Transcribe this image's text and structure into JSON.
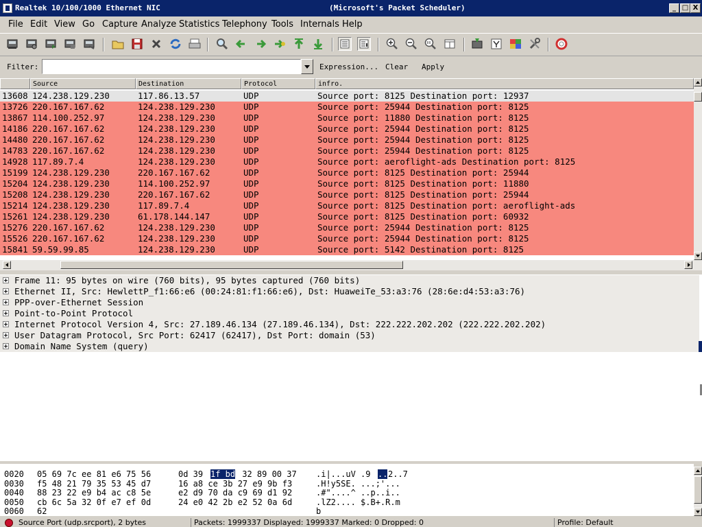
{
  "window": {
    "title_left": "Realtek 10/100/1000 Ethernet NIC",
    "title_right": "(Microsoft's Packet Scheduler)",
    "minimize": "_",
    "maximize": "□",
    "close": "X"
  },
  "menu": [
    "File",
    "Edit",
    "View",
    "Go",
    "Capture",
    "Analyze",
    "Statistics",
    "Telephony",
    "Tools",
    "Internals",
    "Help"
  ],
  "filter": {
    "label": "Filter:",
    "value": "",
    "expression": "Expression...",
    "clear": "Clear",
    "apply": "Apply"
  },
  "packet_list": {
    "columns": [
      "Source",
      "Destination",
      "Protocol",
      "infro."
    ],
    "rows": [
      {
        "no": "13608",
        "src": "124.238.129.230",
        "dst": "117.86.13.57",
        "proto": "UDP",
        "info": "Source port: 8125  Destination port: 12937",
        "color": "normal"
      },
      {
        "no": "13726",
        "src": "220.167.167.62",
        "dst": "124.238.129.230",
        "proto": "UDP",
        "info": "Source port: 25944  Destination port: 8125",
        "color": "red"
      },
      {
        "no": "13867",
        "src": "114.100.252.97",
        "dst": "124.238.129.230",
        "proto": "UDP",
        "info": "Source port: 11880  Destination port: 8125",
        "color": "red"
      },
      {
        "no": "14186",
        "src": "220.167.167.62",
        "dst": "124.238.129.230",
        "proto": "UDP",
        "info": "Source port: 25944  Destination port: 8125",
        "color": "red"
      },
      {
        "no": "14480",
        "src": "220.167.167.62",
        "dst": "124.238.129.230",
        "proto": "UDP",
        "info": "Source port: 25944  Destination port: 8125",
        "color": "red"
      },
      {
        "no": "14783",
        "src": "220.167.167.62",
        "dst": "124.238.129.230",
        "proto": "UDP",
        "info": "Source port: 25944  Destination port: 8125",
        "color": "red"
      },
      {
        "no": "14928",
        "src": "117.89.7.4",
        "dst": "124.238.129.230",
        "proto": "UDP",
        "info": "Source port: aeroflight-ads  Destination port: 8125",
        "color": "red"
      },
      {
        "no": "15199",
        "src": "124.238.129.230",
        "dst": "220.167.167.62",
        "proto": "UDP",
        "info": "Source port: 8125  Destination port: 25944",
        "color": "red"
      },
      {
        "no": "15204",
        "src": "124.238.129.230",
        "dst": "114.100.252.97",
        "proto": "UDP",
        "info": "Source port: 8125  Destination port: 11880",
        "color": "red"
      },
      {
        "no": "15208",
        "src": "124.238.129.230",
        "dst": "220.167.167.62",
        "proto": "UDP",
        "info": "Source port: 8125  Destination port: 25944",
        "color": "red"
      },
      {
        "no": "15214",
        "src": "124.238.129.230",
        "dst": "117.89.7.4",
        "proto": "UDP",
        "info": "Source port: 8125  Destination port: aeroflight-ads",
        "color": "red"
      },
      {
        "no": "15261",
        "src": "124.238.129.230",
        "dst": "61.178.144.147",
        "proto": "UDP",
        "info": "Source port: 8125  Destination port: 60932",
        "color": "red"
      },
      {
        "no": "15276",
        "src": "220.167.167.62",
        "dst": "124.238.129.230",
        "proto": "UDP",
        "info": "Source port: 25944  Destination port: 8125",
        "color": "red"
      },
      {
        "no": "15526",
        "src": "220.167.167.62",
        "dst": "124.238.129.230",
        "proto": "UDP",
        "info": "Source port: 25944  Destination port: 8125",
        "color": "red"
      },
      {
        "no": "15841",
        "src": "59.59.99.85",
        "dst": "124.238.129.230",
        "proto": "UDP",
        "info": "Source port: 5142  Destination port: 8125",
        "color": "red"
      }
    ]
  },
  "details": [
    "Frame 11: 95 bytes on wire (760 bits), 95 bytes captured (760 bits)",
    "Ethernet II, Src: HewlettP_f1:66:e6 (00:24:81:f1:66:e6), Dst: HuaweiTe_53:a3:76 (28:6e:d4:53:a3:76)",
    "PPP-over-Ethernet Session",
    "Point-to-Point Protocol",
    "Internet Protocol Version 4, Src: 27.189.46.134 (27.189.46.134), Dst: 222.222.202.202 (222.222.202.202)",
    "User Datagram Protocol, Src Port: 62417 (62417), Dst Port: domain (53)",
    "Domain Name System (query)"
  ],
  "hex": [
    {
      "offset": "0020",
      "a": "05 69 7c ee 81 e6 75 56",
      "b1": "0d 39 ",
      "hl": "1f bd",
      "b2": " 32 89 00 37",
      "ascii1": ".i|...uV .9",
      "ascii_hl": "..",
      "ascii2": "2..7"
    },
    {
      "offset": "0030",
      "a": "f5 48 21 79 35 53 45 d7",
      "b1": "16 a8 ce 3b 27 e9 9b f3",
      "hl": "",
      "b2": "",
      "ascii1": ".H!y5SE. ...;'...",
      "ascii_hl": "",
      "ascii2": ""
    },
    {
      "offset": "0040",
      "a": "88 23 22 e9 b4 ac c8 5e",
      "b1": "e2 d9 70 da c9 69 d1 92",
      "hl": "",
      "b2": "",
      "ascii1": ".#\"....^ ..p..i..",
      "ascii_hl": "",
      "ascii2": ""
    },
    {
      "offset": "0050",
      "a": "cb 6c 5a 32 0f e7 ef 0d",
      "b1": "24 e0 42 2b e2 52 0a 6d",
      "hl": "",
      "b2": "",
      "ascii1": ".lZ2.... $.B+.R.m",
      "ascii_hl": "",
      "ascii2": ""
    },
    {
      "offset": "0060",
      "a": "62",
      "b1": "",
      "hl": "",
      "b2": "",
      "ascii1": "b",
      "ascii_hl": "",
      "ascii2": ""
    }
  ],
  "status": {
    "field": "Source Port (udp.srcport), 2 bytes",
    "packets": "Packets: 1999337 Displayed: 1999337 Marked: 0 Dropped: 0",
    "profile": "Profile: Default"
  }
}
